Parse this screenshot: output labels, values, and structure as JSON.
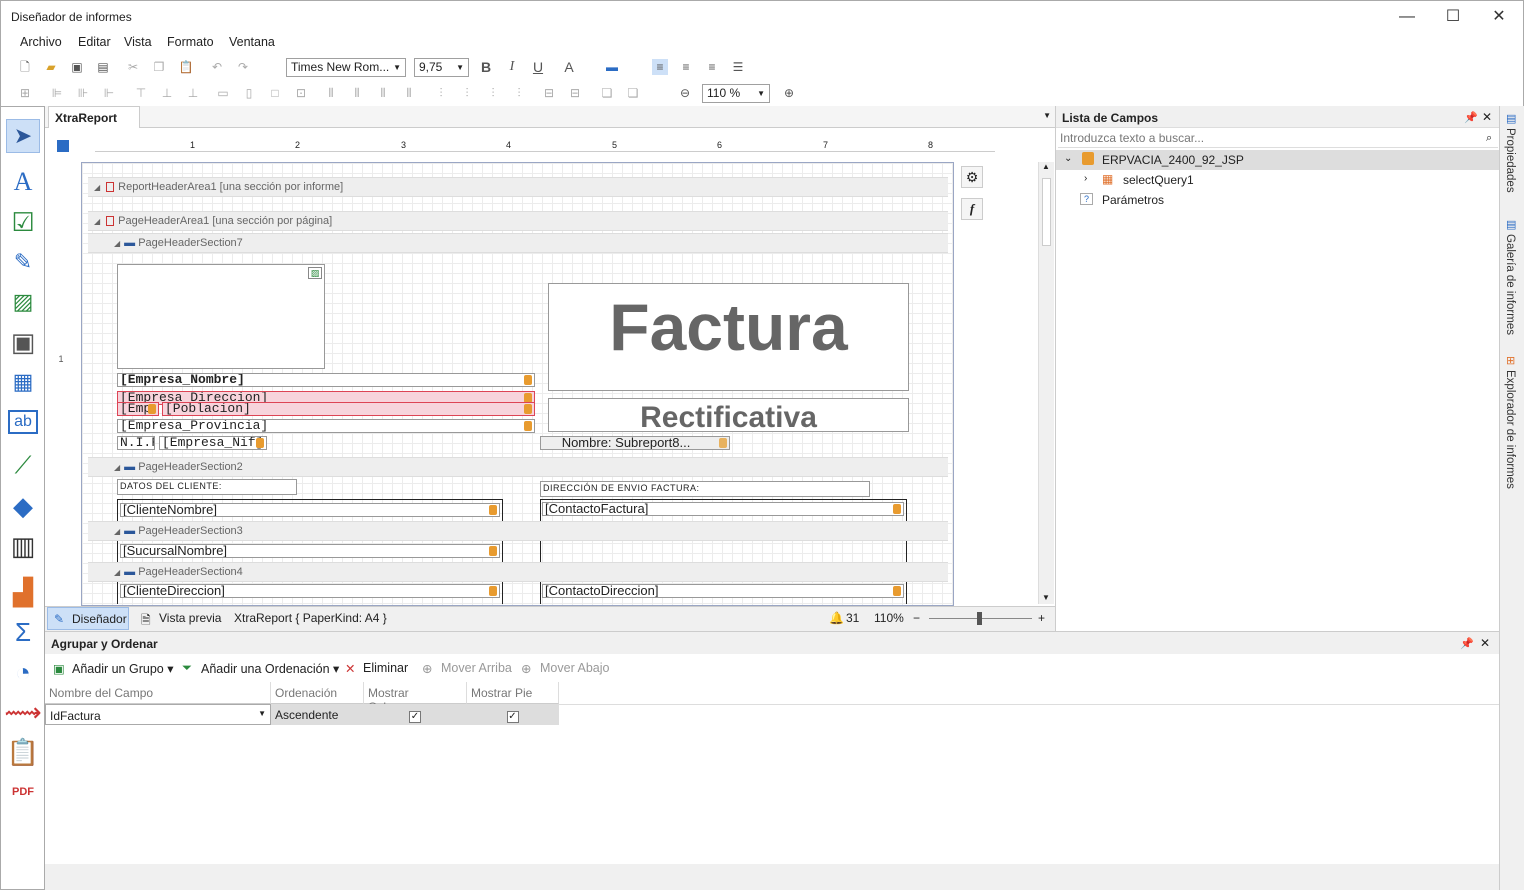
{
  "window": {
    "title": "Diseñador de informes",
    "min": "—",
    "max": "☐",
    "close": "✕"
  },
  "menu": [
    "Archivo",
    "Editar",
    "Vista",
    "Formato",
    "Ventana"
  ],
  "toolbar": {
    "font": "Times New Rom...",
    "size": "9,75",
    "bold": "B",
    "italic": "I",
    "underline": "U",
    "zoom": "110 %"
  },
  "doc_tab": {
    "label": "XtraReport",
    "close": "✕"
  },
  "ruler": [
    "1",
    "2",
    "3",
    "4",
    "5",
    "6",
    "7",
    "8"
  ],
  "vruler": "1",
  "bands": {
    "report_header": "ReportHeaderArea1 [una sección por informe]",
    "page_header": "PageHeaderArea1 [una sección por página]",
    "sec7": "PageHeaderSection7",
    "sec2": "PageHeaderSection2",
    "sec3": "PageHeaderSection3",
    "sec4": "PageHeaderSection4"
  },
  "fields": {
    "empresa_nombre": "[Empresa_Nombre]",
    "empresa_direccion": "[Empresa_Direccion]",
    "empresa_emp": "[Emp",
    "poblacion": "[Poblacion]",
    "empresa_provincia": "[Empresa_Provincia]",
    "nif_label": "N.I.F.",
    "empresa_nif": "[Empresa_Nif]",
    "factura": "Factura",
    "rectificativa": "Rectificativa",
    "subreport": "Nombre: Subreport8...",
    "datos_cliente": "DATOS DEL CLIENTE:",
    "direccion_envio": "DIRECCIÓN DE ENVIO FACTURA:",
    "cliente_nombre": "[ClienteNombre]",
    "contacto_factura": "[ContactoFactura]",
    "sucursal_nombre": "[SucursalNombre]",
    "cliente_direccion": "[ClienteDireccion]",
    "contacto_direccion": "[ContactoDireccion]"
  },
  "status": {
    "designer": "Diseñador",
    "preview": "Vista previa",
    "info": "XtraReport { PaperKind: A4 }",
    "count": "31",
    "zoom": "110%",
    "minus": "−",
    "plus": "+"
  },
  "field_list": {
    "title": "Lista de Campos",
    "search_placeholder": "Introduzca texto a buscar...",
    "root": "ERPVACIA_2400_92_JSP",
    "query": "selectQuery1",
    "params": "Parámetros"
  },
  "side_tabs": [
    "Propiedades",
    "Galería de informes",
    "Explorador de informes"
  ],
  "group": {
    "title": "Agrupar y Ordenar",
    "add_group": "Añadir un Grupo",
    "add_sort": "Añadir una Ordenación",
    "delete": "Eliminar",
    "move_up": "Mover Arriba",
    "move_down": "Mover Abajo",
    "columns": [
      "Nombre del Campo",
      "Ordenación",
      "Mostrar Cabecera",
      "Mostrar Pie"
    ],
    "row": {
      "field": "IdFactura",
      "order": "Ascendente",
      "header": "✓",
      "footer": "✓"
    }
  },
  "colors": {
    "accent": "#2b579a",
    "pink": "#f7d4dc",
    "db_icon": "#e89b2f"
  }
}
